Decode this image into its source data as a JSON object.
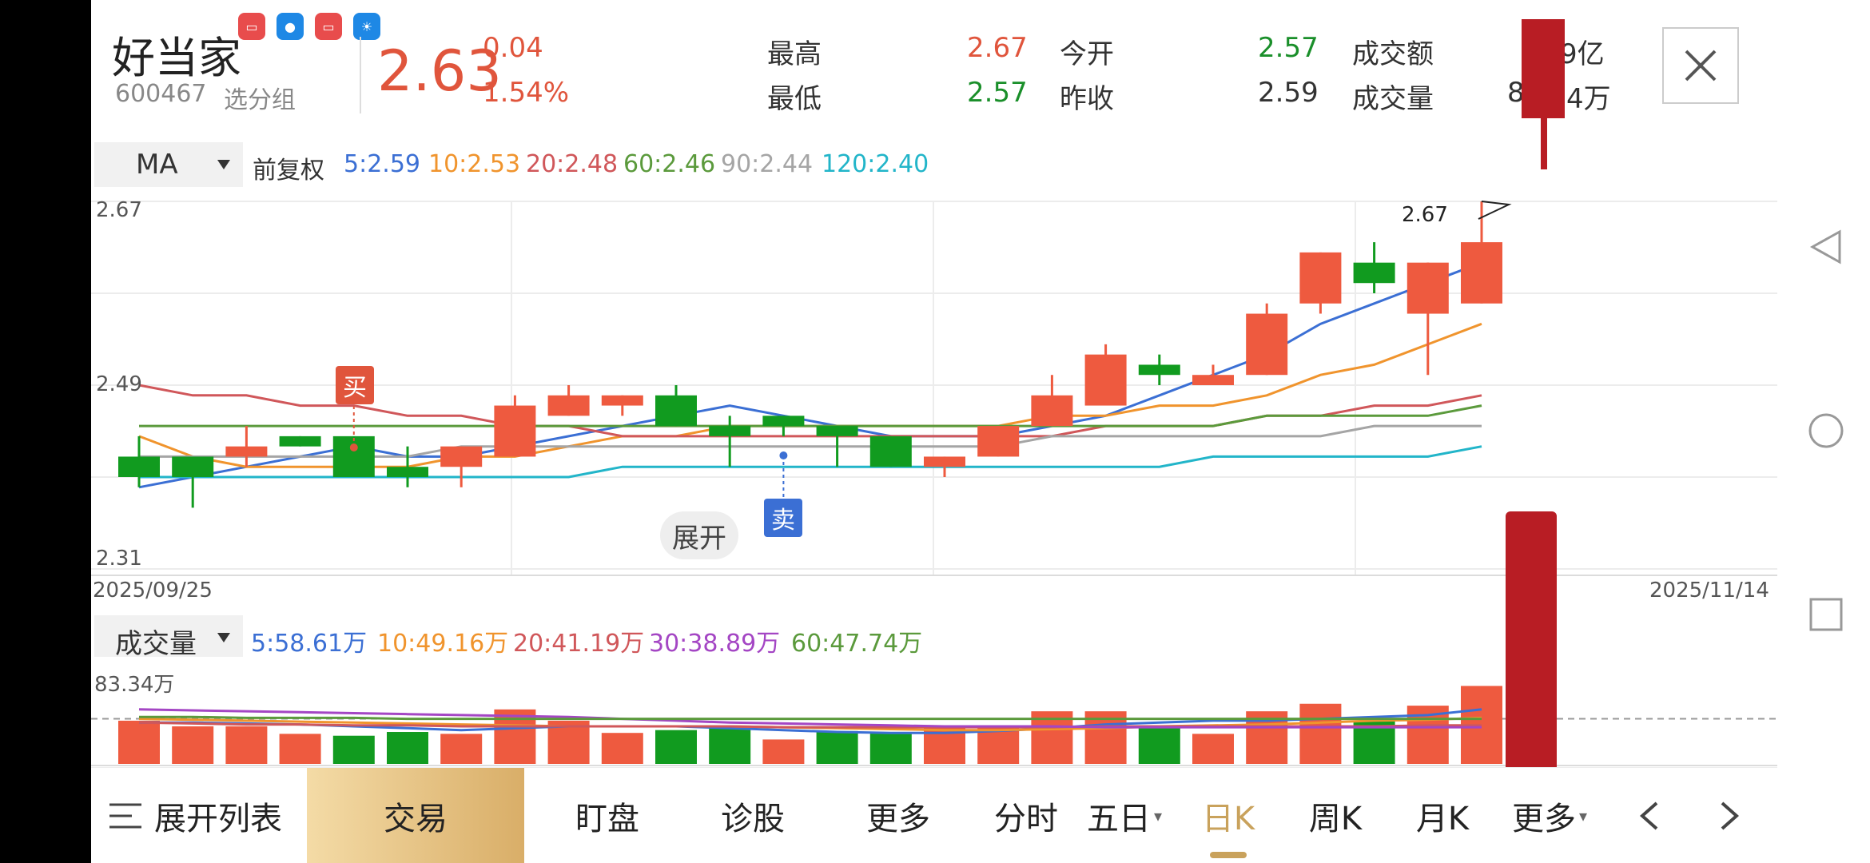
{
  "header": {
    "stock_name": "好当家",
    "stock_code": "600467",
    "group_link": "选分组",
    "price": "2.63",
    "change": "0.04",
    "change_pct": "1.54%",
    "stats": {
      "high_label": "最高",
      "high": "2.67",
      "low_label": "最低",
      "low": "2.57",
      "open_label": "今开",
      "open": "2.57",
      "prev_close_label": "昨收",
      "prev_close": "2.59",
      "amount_label": "成交额",
      "amount": "9亿",
      "volume_label": "成交量",
      "volume": "8",
      "volume_suffix": "4万"
    }
  },
  "toolbar": {
    "indicator": "MA",
    "adjust": "前复权",
    "ma": [
      {
        "text": "5:2.59",
        "color": "#3b6fd4"
      },
      {
        "text": "10:2.53",
        "color": "#f0942d"
      },
      {
        "text": "20:2.48",
        "color": "#d0575a"
      },
      {
        "text": "60:2.46",
        "color": "#5b9a3c"
      },
      {
        "text": "90:2.44",
        "color": "#a5a5a5"
      },
      {
        "text": "120:2.40",
        "color": "#22b5c9"
      }
    ]
  },
  "chart_labels": {
    "y_top": "2.67",
    "y_mid": "2.49",
    "y_bottom": "2.31",
    "date_start": "2025/09/25",
    "date_end": "2025/11/14",
    "high_marker": "2.67",
    "buy": "买",
    "sell": "卖",
    "expand": "展开"
  },
  "volume_toolbar": {
    "indicator": "成交量",
    "ma": [
      {
        "text": "5:58.61万",
        "color": "#3b6fd4"
      },
      {
        "text": "10:49.16万",
        "color": "#f0942d"
      },
      {
        "text": "20:41.19万",
        "color": "#d0575a"
      },
      {
        "text": "30:38.89万",
        "color": "#a446c4"
      },
      {
        "text": "60:47.74万",
        "color": "#5b9a3c"
      }
    ],
    "y_top": "83.34万"
  },
  "chart_data": [
    {
      "type": "candlestick",
      "ylim": [
        2.31,
        2.67
      ],
      "candles": [
        {
          "o": 2.42,
          "c": 2.4,
          "h": 2.44,
          "l": 2.39
        },
        {
          "o": 2.42,
          "c": 2.4,
          "h": 2.42,
          "l": 2.37
        },
        {
          "o": 2.42,
          "c": 2.43,
          "h": 2.45,
          "l": 2.41
        },
        {
          "o": 2.44,
          "c": 2.43,
          "h": 2.44,
          "l": 2.43
        },
        {
          "o": 2.44,
          "c": 2.4,
          "h": 2.44,
          "l": 2.4
        },
        {
          "o": 2.41,
          "c": 2.4,
          "h": 2.43,
          "l": 2.39
        },
        {
          "o": 2.41,
          "c": 2.43,
          "h": 2.43,
          "l": 2.39
        },
        {
          "o": 2.42,
          "c": 2.47,
          "h": 2.48,
          "l": 2.42
        },
        {
          "o": 2.46,
          "c": 2.48,
          "h": 2.49,
          "l": 2.46
        },
        {
          "o": 2.47,
          "c": 2.48,
          "h": 2.48,
          "l": 2.46
        },
        {
          "o": 2.48,
          "c": 2.45,
          "h": 2.49,
          "l": 2.45
        },
        {
          "o": 2.45,
          "c": 2.44,
          "h": 2.46,
          "l": 2.41
        },
        {
          "o": 2.46,
          "c": 2.45,
          "h": 2.46,
          "l": 2.44
        },
        {
          "o": 2.45,
          "c": 2.44,
          "h": 2.45,
          "l": 2.41
        },
        {
          "o": 2.44,
          "c": 2.41,
          "h": 2.44,
          "l": 2.41
        },
        {
          "o": 2.41,
          "c": 2.42,
          "h": 2.42,
          "l": 2.4
        },
        {
          "o": 2.42,
          "c": 2.45,
          "h": 2.45,
          "l": 2.42
        },
        {
          "o": 2.45,
          "c": 2.48,
          "h": 2.5,
          "l": 2.45
        },
        {
          "o": 2.47,
          "c": 2.52,
          "h": 2.53,
          "l": 2.47
        },
        {
          "o": 2.51,
          "c": 2.5,
          "h": 2.52,
          "l": 2.49
        },
        {
          "o": 2.49,
          "c": 2.5,
          "h": 2.51,
          "l": 2.49
        },
        {
          "o": 2.5,
          "c": 2.56,
          "h": 2.57,
          "l": 2.5
        },
        {
          "o": 2.57,
          "c": 2.62,
          "h": 2.62,
          "l": 2.56
        },
        {
          "o": 2.61,
          "c": 2.59,
          "h": 2.63,
          "l": 2.58
        },
        {
          "o": 2.56,
          "c": 2.61,
          "h": 2.61,
          "l": 2.5
        },
        {
          "o": 2.57,
          "c": 2.63,
          "h": 2.67,
          "l": 2.57
        }
      ],
      "ma_lines": [
        {
          "name": "5",
          "color": "#3b6fd4",
          "values": [
            2.39,
            2.4,
            2.41,
            2.42,
            2.43,
            2.42,
            2.42,
            2.43,
            2.44,
            2.45,
            2.46,
            2.47,
            2.46,
            2.45,
            2.44,
            2.44,
            2.44,
            2.45,
            2.46,
            2.48,
            2.5,
            2.52,
            2.55,
            2.57,
            2.59,
            2.61
          ]
        },
        {
          "name": "10",
          "color": "#f0942d",
          "values": [
            2.44,
            2.42,
            2.41,
            2.41,
            2.41,
            2.41,
            2.42,
            2.42,
            2.43,
            2.44,
            2.44,
            2.45,
            2.45,
            2.45,
            2.45,
            2.45,
            2.45,
            2.46,
            2.46,
            2.47,
            2.47,
            2.48,
            2.5,
            2.51,
            2.53,
            2.55
          ]
        },
        {
          "name": "20",
          "color": "#d0575a",
          "values": [
            2.49,
            2.48,
            2.48,
            2.47,
            2.47,
            2.46,
            2.46,
            2.45,
            2.45,
            2.44,
            2.44,
            2.44,
            2.44,
            2.44,
            2.44,
            2.44,
            2.44,
            2.44,
            2.45,
            2.45,
            2.45,
            2.46,
            2.46,
            2.47,
            2.47,
            2.48
          ]
        },
        {
          "name": "60",
          "color": "#5b9a3c",
          "values": [
            2.45,
            2.45,
            2.45,
            2.45,
            2.45,
            2.45,
            2.45,
            2.45,
            2.45,
            2.45,
            2.45,
            2.45,
            2.45,
            2.45,
            2.45,
            2.45,
            2.45,
            2.45,
            2.45,
            2.45,
            2.45,
            2.46,
            2.46,
            2.46,
            2.46,
            2.47
          ]
        },
        {
          "name": "90",
          "color": "#a5a5a5",
          "values": [
            2.42,
            2.42,
            2.42,
            2.42,
            2.42,
            2.42,
            2.43,
            2.43,
            2.43,
            2.43,
            2.43,
            2.43,
            2.43,
            2.43,
            2.43,
            2.43,
            2.43,
            2.44,
            2.44,
            2.44,
            2.44,
            2.44,
            2.44,
            2.45,
            2.45,
            2.45
          ]
        },
        {
          "name": "120",
          "color": "#22b5c9",
          "values": [
            2.4,
            2.4,
            2.4,
            2.4,
            2.4,
            2.4,
            2.4,
            2.4,
            2.4,
            2.41,
            2.41,
            2.41,
            2.41,
            2.41,
            2.41,
            2.41,
            2.41,
            2.41,
            2.41,
            2.41,
            2.42,
            2.42,
            2.42,
            2.42,
            2.42,
            2.43
          ]
        }
      ]
    },
    {
      "type": "bar",
      "ylim": [
        0,
        83.34
      ],
      "values": [
        46,
        40,
        40,
        32,
        30,
        34,
        32,
        58,
        46,
        33,
        36,
        38,
        26,
        35,
        34,
        40,
        38,
        56,
        56,
        39,
        32,
        56,
        64,
        46,
        62,
        83
      ],
      "up": [
        1,
        1,
        1,
        1,
        0,
        0,
        1,
        1,
        1,
        1,
        0,
        0,
        1,
        0,
        0,
        1,
        1,
        1,
        1,
        0,
        1,
        1,
        1,
        0,
        1,
        1
      ],
      "ma_lines": [
        {
          "name": "5",
          "color": "#3b6fd4",
          "values": [
            44,
            44,
            43,
            42,
            40,
            38,
            36,
            38,
            40,
            40,
            40,
            38,
            36,
            34,
            33,
            33,
            35,
            38,
            42,
            44,
            46,
            46,
            48,
            50,
            52,
            58
          ]
        },
        {
          "name": "10",
          "color": "#f0942d",
          "values": [
            48,
            47,
            46,
            45,
            44,
            43,
            42,
            41,
            40,
            40,
            40,
            40,
            39,
            38,
            37,
            36,
            36,
            37,
            38,
            40,
            41,
            42,
            44,
            46,
            47,
            49
          ]
        },
        {
          "name": "20",
          "color": "#d0575a",
          "values": [
            44,
            43,
            42,
            42,
            41,
            41,
            40,
            40,
            40,
            40,
            40,
            40,
            39,
            39,
            39,
            39,
            39,
            39,
            40,
            40,
            40,
            40,
            40,
            40,
            41,
            41
          ]
        },
        {
          "name": "30",
          "color": "#a446c4",
          "values": [
            58,
            57,
            56,
            55,
            54,
            53,
            52,
            51,
            50,
            48,
            46,
            44,
            43,
            42,
            41,
            40,
            40,
            40,
            39,
            39,
            39,
            39,
            39,
            39,
            39,
            39
          ]
        },
        {
          "name": "60",
          "color": "#5b9a3c",
          "values": [
            50,
            50,
            49,
            49,
            49,
            48,
            48,
            48,
            48,
            48,
            48,
            48,
            48,
            48,
            48,
            48,
            48,
            48,
            48,
            48,
            48,
            48,
            48,
            48,
            48,
            48
          ]
        }
      ]
    }
  ],
  "bottom_nav": {
    "list": "展开列表",
    "trade": "交易",
    "watch": "盯盘",
    "diagnose": "诊股",
    "more": "更多",
    "intraday": "分时",
    "five_day": "五日",
    "daily": "日K",
    "weekly": "周K",
    "monthly": "月K",
    "more2": "更多"
  }
}
